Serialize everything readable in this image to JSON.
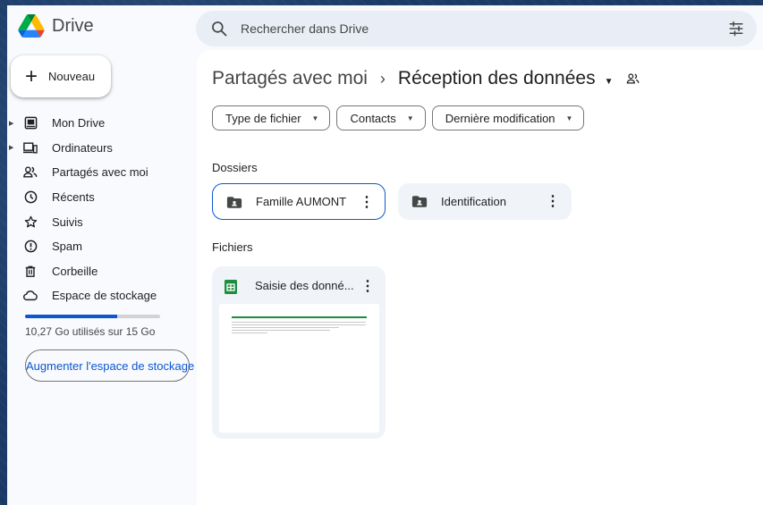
{
  "app": {
    "name": "Drive"
  },
  "search": {
    "placeholder": "Rechercher dans Drive"
  },
  "sidebar": {
    "new_label": "Nouveau",
    "items": [
      {
        "label": "Mon Drive",
        "icon": "my-drive-icon"
      },
      {
        "label": "Ordinateurs",
        "icon": "computers-icon"
      },
      {
        "label": "Partagés avec moi",
        "icon": "shared-icon"
      },
      {
        "label": "Récents",
        "icon": "clock-icon"
      },
      {
        "label": "Suivis",
        "icon": "star-icon"
      },
      {
        "label": "Spam",
        "icon": "spam-icon"
      },
      {
        "label": "Corbeille",
        "icon": "trash-icon"
      },
      {
        "label": "Espace de stockage",
        "icon": "cloud-icon"
      }
    ],
    "storage": {
      "used_fraction": 0.685,
      "text": "10,27 Go utilisés sur 15 Go",
      "upgrade_label": "Augmenter l'espace de stockage"
    }
  },
  "main": {
    "breadcrumb": {
      "root": "Partagés avec moi",
      "separator": "›",
      "current": "Réception des données"
    },
    "filters": [
      "Type de fichier",
      "Contacts",
      "Dernière modification"
    ],
    "folders_title": "Dossiers",
    "folders": [
      {
        "name": "Famille AUMONT",
        "selected": true
      },
      {
        "name": "Identification",
        "selected": false
      }
    ],
    "files_title": "Fichiers",
    "files": [
      {
        "name": "Saisie des donné..."
      }
    ]
  },
  "colors": {
    "accent": "#0b57d0",
    "sheets_green": "#1e8e3e",
    "surface": "#f0f4f9"
  }
}
